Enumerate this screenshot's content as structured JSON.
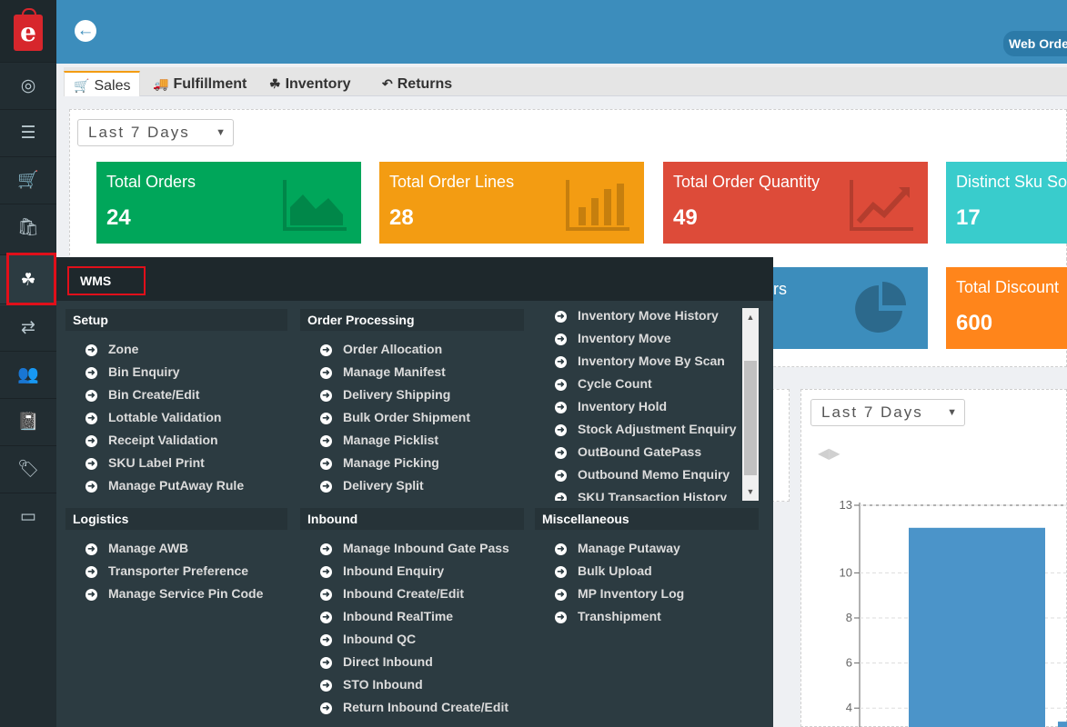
{
  "header": {
    "back_icon": "arrow-circle-left-icon",
    "web_order_label": "Web Orde"
  },
  "sidebar": {
    "items": [
      {
        "icon": "dashboard-icon",
        "glyph": "◎"
      },
      {
        "icon": "list-icon",
        "glyph": "☰"
      },
      {
        "icon": "cart-icon",
        "glyph": "🛒"
      },
      {
        "icon": "shopping-bag-icon",
        "glyph": "🛍"
      },
      {
        "icon": "cubes-icon",
        "glyph": "☘"
      },
      {
        "icon": "exchange-icon",
        "glyph": "⇄"
      },
      {
        "icon": "user-plus-icon",
        "glyph": "👥"
      },
      {
        "icon": "book-icon",
        "glyph": "📓"
      },
      {
        "icon": "tag-icon",
        "glyph": "🏷"
      },
      {
        "icon": "credit-card-icon",
        "glyph": "▭"
      }
    ]
  },
  "tabs": [
    {
      "label": "Sales",
      "icon": "cart-icon",
      "glyph": "🛒"
    },
    {
      "label": "Fulfillment",
      "icon": "truck-icon",
      "glyph": "🚚"
    },
    {
      "label": "Inventory",
      "icon": "cubes-icon",
      "glyph": "☘"
    },
    {
      "label": "Returns",
      "icon": "reply-icon",
      "glyph": "↶"
    }
  ],
  "filter": {
    "value": "Last 7 Days"
  },
  "cards": [
    {
      "title": "Total Orders",
      "value": "24",
      "color": "#00a65a",
      "icon": "area-chart-icon"
    },
    {
      "title": "Total Order Lines",
      "value": "28",
      "color": "#f39c12",
      "icon": "bar-chart-icon"
    },
    {
      "title": "Total Order Quantity",
      "value": "49",
      "color": "#dd4b39",
      "icon": "line-chart-icon"
    },
    {
      "title": "Distinct Sku So",
      "value": "17",
      "color": "#39cccc",
      "icon": "list-icon"
    }
  ],
  "cards_row2": [
    {
      "title": "rs",
      "value": "",
      "color": "#3c8dbc",
      "icon": "pie-chart-icon"
    },
    {
      "title": "Total Discount",
      "value": "600",
      "color": "#ff851b",
      "icon": "tag-icon"
    }
  ],
  "chart_filter": {
    "value": "Last 7 Days"
  },
  "chart_data": {
    "type": "bar",
    "title": "",
    "xlabel": "",
    "ylabel": "",
    "y_ticks": [
      "13",
      "10",
      "8",
      "6",
      "4"
    ],
    "ylim": [
      3,
      13
    ],
    "series": [
      {
        "values": [
          12,
          3.4
        ]
      }
    ],
    "colors": [
      "#4b94c9",
      "#4b94c9"
    ]
  },
  "wms": {
    "title": "WMS",
    "sections": [
      {
        "name": "Setup",
        "items": [
          "Zone",
          "Bin Enquiry",
          "Bin Create/Edit",
          "Lottable Validation",
          "Receipt Validation",
          "SKU Label Print",
          "Manage PutAway Rule"
        ]
      },
      {
        "name": "Order Processing",
        "items": [
          "Order Allocation",
          "Manage Manifest",
          "Delivery Shipping",
          "Bulk Order Shipment",
          "Manage Picklist",
          "Manage Picking",
          "Delivery Split"
        ]
      },
      {
        "name": "",
        "items": [
          "Inventory Move History",
          "Inventory Move",
          "Inventory Move By Scan",
          "Cycle Count",
          "Inventory Hold",
          "Stock Adjustment Enquiry",
          "OutBound GatePass",
          "Outbound Memo Enquiry",
          "SKU Transaction History"
        ]
      },
      {
        "name": "Logistics",
        "items": [
          "Manage AWB",
          "Transporter Preference",
          "Manage Service Pin Code"
        ]
      },
      {
        "name": "Inbound",
        "items": [
          "Manage Inbound Gate Pass",
          "Inbound Enquiry",
          "Inbound Create/Edit",
          "Inbound RealTime",
          "Inbound QC",
          "Direct Inbound",
          "STO Inbound",
          "Return Inbound Create/Edit"
        ]
      },
      {
        "name": "Miscellaneous",
        "items": [
          "Manage Putaway",
          "Bulk Upload",
          "MP Inventory Log",
          "Transhipment"
        ]
      }
    ]
  }
}
